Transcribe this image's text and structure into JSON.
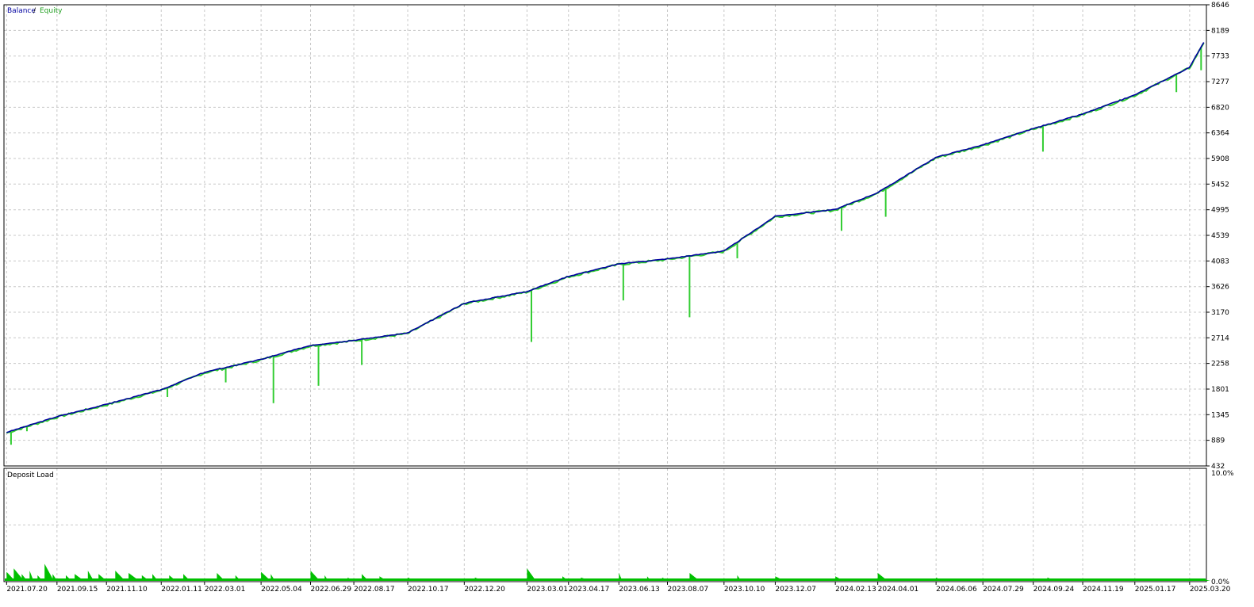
{
  "chart_data": [
    {
      "type": "line",
      "series": [
        {
          "name": "Balance",
          "color": "#0000A0",
          "x": [
            "2021.07.20",
            "2021.09.15",
            "2021.11.10",
            "2022.01.11",
            "2022.03.01",
            "2022.05.04",
            "2022.06.29",
            "2022.08.17",
            "2022.10.17",
            "2022.12.20",
            "2023.03.01",
            "2023.04.17",
            "2023.06.13",
            "2023.08.07",
            "2023.10.10",
            "2023.12.07",
            "2024.02.13",
            "2024.04.01",
            "2024.06.06",
            "2024.07.29",
            "2024.09.24",
            "2024.11.19",
            "2025.01.17",
            "2025.03.20",
            "2025.04.05"
          ],
          "values": [
            1030,
            1310,
            1530,
            1790,
            2100,
            2330,
            2580,
            2670,
            2800,
            3330,
            3540,
            3810,
            4030,
            4120,
            4260,
            4880,
            5000,
            5300,
            5930,
            6150,
            6440,
            6700,
            7040,
            7530,
            7980
          ]
        },
        {
          "name": "Equity",
          "color": "#32CD32",
          "x": [
            "2021.07.20",
            "2021.09.15",
            "2021.11.10",
            "2022.01.11",
            "2022.03.01",
            "2022.05.04",
            "2022.06.29",
            "2022.08.17",
            "2022.10.17",
            "2022.12.20",
            "2023.03.01",
            "2023.04.17",
            "2023.06.13",
            "2023.08.07",
            "2023.10.10",
            "2023.12.07",
            "2024.02.13",
            "2024.04.01",
            "2024.06.06",
            "2024.07.29",
            "2024.09.24",
            "2024.11.19",
            "2025.01.17",
            "2025.03.20",
            "2025.04.05"
          ],
          "values": [
            1020,
            1300,
            1520,
            1780,
            2090,
            2320,
            2570,
            2660,
            2790,
            3320,
            3530,
            3800,
            4020,
            4110,
            4250,
            4870,
            4990,
            5290,
            5920,
            6140,
            6430,
            6690,
            7030,
            7520,
            7970
          ],
          "drawdowns": [
            {
              "x": "2021.07.25",
              "low": 810
            },
            {
              "x": "2021.08.12",
              "low": 1050
            },
            {
              "x": "2022.01.18",
              "low": 1660
            },
            {
              "x": "2022.03.25",
              "low": 1920
            },
            {
              "x": "2022.05.18",
              "low": 1550
            },
            {
              "x": "2022.07.08",
              "low": 1860
            },
            {
              "x": "2022.08.26",
              "low": 2230
            },
            {
              "x": "2023.03.06",
              "low": 2640
            },
            {
              "x": "2023.06.18",
              "low": 3380
            },
            {
              "x": "2023.09.01",
              "low": 3080
            },
            {
              "x": "2023.10.25",
              "low": 4130
            },
            {
              "x": "2024.02.20",
              "low": 4620
            },
            {
              "x": "2024.04.10",
              "low": 4870
            },
            {
              "x": "2024.10.05",
              "low": 6030
            },
            {
              "x": "2025.03.05",
              "low": 7090
            },
            {
              "x": "2025.04.02",
              "low": 7480
            }
          ]
        }
      ],
      "legend": {
        "balance_label": "Balance",
        "separator": "/",
        "equity_label": "Equity",
        "position": "top-left"
      },
      "xlim": [
        "2021.07.17",
        "2025.04.08"
      ],
      "x_ticks": [
        "2021.07.20",
        "2021.09.15",
        "2021.11.10",
        "2022.01.11",
        "2022.03.01",
        "2022.05.04",
        "2022.06.29",
        "2022.08.17",
        "2022.10.17",
        "2022.12.20",
        "2023.03.01",
        "2023.04.17",
        "2023.06.13",
        "2023.08.07",
        "2023.10.10",
        "2023.12.07",
        "2024.02.13",
        "2024.04.01",
        "2024.06.06",
        "2024.07.29",
        "2024.09.24",
        "2024.11.19",
        "2025.01.17",
        "2025.03.20"
      ],
      "ylim": [
        432,
        8646
      ],
      "y_ticks": [
        "8646",
        "8189",
        "7733",
        "7277",
        "6820",
        "6364",
        "5908",
        "5452",
        "4995",
        "4539",
        "4083",
        "3626",
        "3170",
        "2714",
        "2258",
        "1801",
        "1345",
        "889",
        "432"
      ],
      "grid": true
    },
    {
      "type": "area",
      "title": "Deposit Load",
      "color": "#00C000",
      "ylim": [
        0,
        10
      ],
      "y_ticks": [
        "10.0%",
        "0.0%"
      ],
      "grid": true,
      "spikes": [
        {
          "x": "2021.07.20",
          "v": 0.8
        },
        {
          "x": "2021.07.28",
          "v": 1.1
        },
        {
          "x": "2021.08.06",
          "v": 0.6
        },
        {
          "x": "2021.08.15",
          "v": 0.9
        },
        {
          "x": "2021.08.24",
          "v": 0.5
        },
        {
          "x": "2021.09.01",
          "v": 1.5
        },
        {
          "x": "2021.09.10",
          "v": 0.6
        },
        {
          "x": "2021.09.25",
          "v": 0.5
        },
        {
          "x": "2021.10.05",
          "v": 0.6
        },
        {
          "x": "2021.10.20",
          "v": 0.9
        },
        {
          "x": "2021.11.01",
          "v": 0.6
        },
        {
          "x": "2021.11.20",
          "v": 0.9
        },
        {
          "x": "2021.12.05",
          "v": 0.7
        },
        {
          "x": "2021.12.20",
          "v": 0.5
        },
        {
          "x": "2022.01.01",
          "v": 0.6
        },
        {
          "x": "2022.01.20",
          "v": 0.5
        },
        {
          "x": "2022.02.05",
          "v": 0.6
        },
        {
          "x": "2022.03.15",
          "v": 0.7
        },
        {
          "x": "2022.04.05",
          "v": 0.5
        },
        {
          "x": "2022.05.04",
          "v": 0.8
        },
        {
          "x": "2022.05.15",
          "v": 0.6
        },
        {
          "x": "2022.06.29",
          "v": 0.9
        },
        {
          "x": "2022.07.15",
          "v": 0.5
        },
        {
          "x": "2022.08.10",
          "v": 0.3
        },
        {
          "x": "2022.08.26",
          "v": 0.6
        },
        {
          "x": "2022.09.15",
          "v": 0.4
        },
        {
          "x": "2022.10.17",
          "v": 0.3
        },
        {
          "x": "2023.01.01",
          "v": 0.3
        },
        {
          "x": "2023.03.01",
          "v": 1.1
        },
        {
          "x": "2023.04.10",
          "v": 0.4
        },
        {
          "x": "2023.05.01",
          "v": 0.3
        },
        {
          "x": "2023.06.13",
          "v": 0.7
        },
        {
          "x": "2023.07.15",
          "v": 0.4
        },
        {
          "x": "2023.08.01",
          "v": 0.3
        },
        {
          "x": "2023.09.01",
          "v": 0.7
        },
        {
          "x": "2023.10.25",
          "v": 0.5
        },
        {
          "x": "2023.12.07",
          "v": 0.4
        },
        {
          "x": "2024.02.13",
          "v": 0.4
        },
        {
          "x": "2024.04.01",
          "v": 0.7
        },
        {
          "x": "2024.06.06",
          "v": 0.3
        },
        {
          "x": "2024.07.29",
          "v": 0.1
        },
        {
          "x": "2024.09.24",
          "v": 0.2
        },
        {
          "x": "2024.10.10",
          "v": 0.3
        },
        {
          "x": "2024.12.15",
          "v": 0.1
        },
        {
          "x": "2025.02.20",
          "v": 0.1
        },
        {
          "x": "2025.03.10",
          "v": 0.1
        },
        {
          "x": "2025.04.02",
          "v": 0.2
        }
      ]
    }
  ]
}
